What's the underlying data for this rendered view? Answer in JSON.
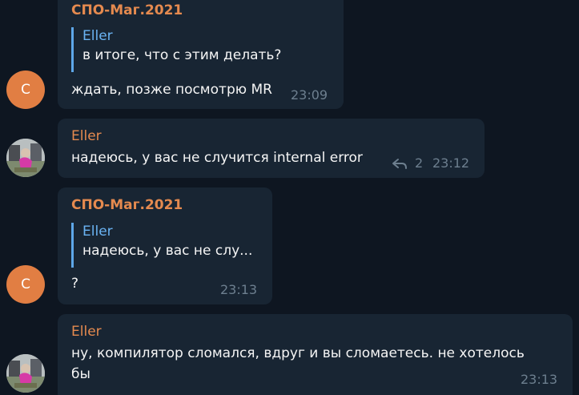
{
  "messages": [
    {
      "author": "СПО-Маг.2021",
      "avatar_letter": "C",
      "reply": {
        "author": "Eller",
        "text": "в итоге, что с этим делать?"
      },
      "text": "ждать, позже посмотрю MR",
      "time": "23:09"
    },
    {
      "author": "Eller",
      "avatar_photo": "user-photo-avatar",
      "text": "надеюсь, у вас не случится internal error",
      "replies": "2",
      "reply_icon": "reply-arrow-icon",
      "time": "23:12"
    },
    {
      "author": "СПО-Маг.2021",
      "avatar_letter": "C",
      "reply": {
        "author": "Eller",
        "text": "надеюсь, у вас не слу..."
      },
      "text": "?",
      "time": "23:13"
    },
    {
      "author": "Eller",
      "avatar_photo": "user-photo-avatar",
      "text_line1": "ну, компилятор сломался, вдруг и вы сломаетесь. не хотелось",
      "text_line2": "бы",
      "time": "23:13"
    }
  ],
  "colors": {
    "background": "#0e1621",
    "bubble": "#182533",
    "author": "#e58a4f",
    "reply_author": "#6ab3f3",
    "reply_bar": "#5ea7e8",
    "avatar_orange": "#e17e43",
    "time": "#6d7f8f"
  }
}
